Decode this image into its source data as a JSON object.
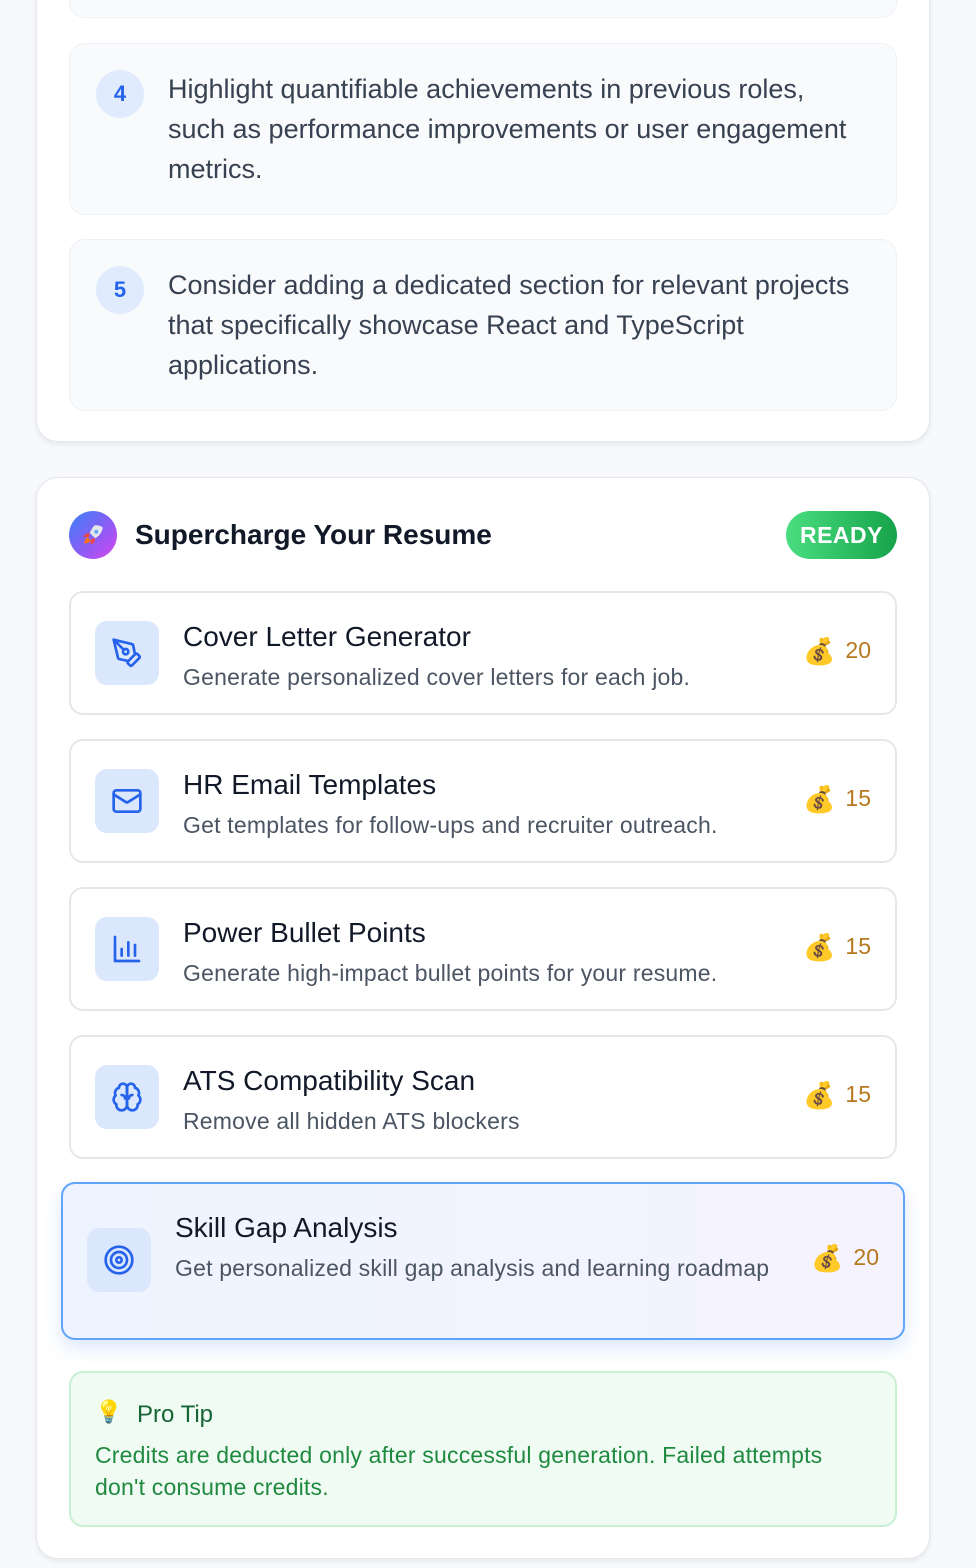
{
  "recommendations": [
    {
      "number": "4",
      "text": "Highlight quantifiable achievements in previous roles, such as performance improvements or user engagement metrics."
    },
    {
      "number": "5",
      "text": "Consider adding a dedicated section for relevant projects that specifically showcase React and TypeScript applications."
    }
  ],
  "supercharge": {
    "title": "Supercharge Your Resume",
    "badge": "READY",
    "icon": "rocket-icon",
    "features": [
      {
        "title": "Cover Letter Generator",
        "description": "Generate personalized cover letters for each job.",
        "credits": "20",
        "icon": "pen-tool-icon"
      },
      {
        "title": "HR Email Templates",
        "description": "Get templates for follow-ups and recruiter outreach.",
        "credits": "15",
        "icon": "mail-icon"
      },
      {
        "title": "Power Bullet Points",
        "description": "Generate high-impact bullet points for your resume.",
        "credits": "15",
        "icon": "bar-chart-icon"
      },
      {
        "title": "ATS Compatibility Scan",
        "description": "Remove all hidden ATS blockers",
        "credits": "15",
        "icon": "brain-icon"
      },
      {
        "title": "Skill Gap Analysis",
        "description": "Get personalized skill gap analysis and learning roadmap",
        "credits": "20",
        "icon": "target-icon",
        "selected": true
      }
    ],
    "credit_icon": "money-bag-icon",
    "pro_tip": {
      "title": "Pro Tip",
      "text": "Credits are deducted only after successful generation. Failed attempts don't consume credits.",
      "icon": "lightbulb-icon"
    }
  },
  "colors": {
    "accent": "#2563eb",
    "badge_green": "#22c55e",
    "credits": "#b7791f",
    "tip_green": "#1f8a3f"
  }
}
